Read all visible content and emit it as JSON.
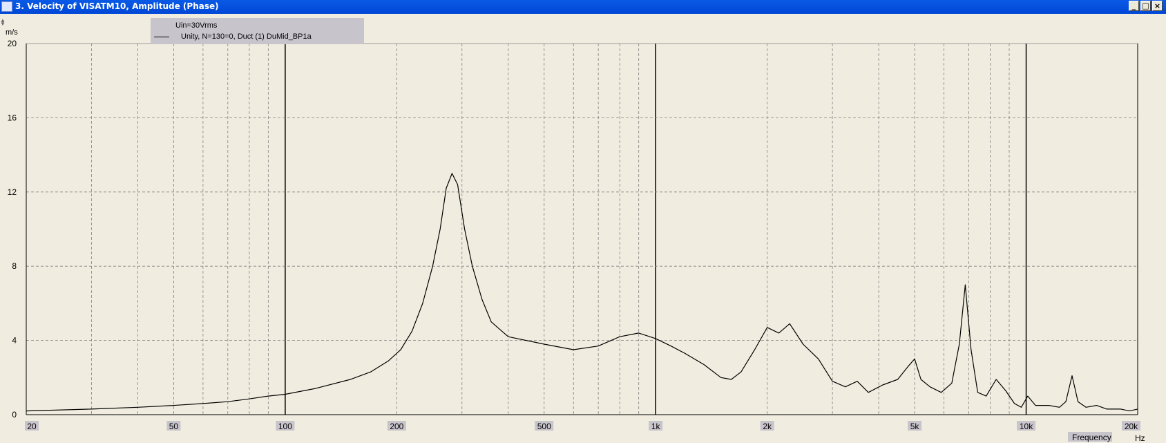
{
  "window": {
    "title": "3. Velocity of VISATM10, Amplitude (Phase)",
    "buttons": [
      "_",
      "□",
      "×"
    ]
  },
  "legend": {
    "header": "Uin=30Vrms",
    "series_label": "Unity, N=130=0, Duct (1) DuMid_BP1a"
  },
  "axes": {
    "y_unit": "m/s",
    "x_unit": "Hz",
    "x_title": "Frequency",
    "y_ticks": [
      "0",
      "4",
      "8",
      "12",
      "16",
      "20"
    ],
    "x_tick_labels": [
      "20",
      "50",
      "100",
      "200",
      "500",
      "1k",
      "2k",
      "5k",
      "10k",
      "20k"
    ]
  },
  "colors": {
    "background": "#f0ecdf",
    "grid": "#808080",
    "curve": "#000000",
    "titlebar": "#0054e3"
  },
  "chart_data": {
    "type": "line",
    "x_scale": "log",
    "xlim": [
      20,
      20000
    ],
    "ylim": [
      0,
      20
    ],
    "grid": true,
    "series": [
      {
        "name": "Unity, N=130=0, Duct (1) DuMid_BP1a",
        "points": [
          [
            20,
            0.2
          ],
          [
            30,
            0.3
          ],
          [
            40,
            0.4
          ],
          [
            50,
            0.5
          ],
          [
            60,
            0.6
          ],
          [
            70,
            0.7
          ],
          [
            80,
            0.85
          ],
          [
            90,
            1.0
          ],
          [
            100,
            1.1
          ],
          [
            120,
            1.4
          ],
          [
            150,
            1.9
          ],
          [
            170,
            2.3
          ],
          [
            190,
            2.9
          ],
          [
            205,
            3.5
          ],
          [
            220,
            4.5
          ],
          [
            235,
            6.0
          ],
          [
            250,
            8.0
          ],
          [
            262,
            10.0
          ],
          [
            272,
            12.2
          ],
          [
            282,
            13.0
          ],
          [
            292,
            12.4
          ],
          [
            305,
            10.0
          ],
          [
            320,
            8.0
          ],
          [
            340,
            6.2
          ],
          [
            360,
            5.0
          ],
          [
            400,
            4.2
          ],
          [
            500,
            3.8
          ],
          [
            600,
            3.5
          ],
          [
            700,
            3.7
          ],
          [
            800,
            4.2
          ],
          [
            900,
            4.4
          ],
          [
            1000,
            4.1
          ],
          [
            1100,
            3.7
          ],
          [
            1200,
            3.3
          ],
          [
            1350,
            2.7
          ],
          [
            1500,
            2.0
          ],
          [
            1600,
            1.9
          ],
          [
            1700,
            2.3
          ],
          [
            1850,
            3.5
          ],
          [
            2000,
            4.7
          ],
          [
            2150,
            4.4
          ],
          [
            2300,
            4.9
          ],
          [
            2500,
            3.8
          ],
          [
            2750,
            3.0
          ],
          [
            3000,
            1.8
          ],
          [
            3250,
            1.5
          ],
          [
            3500,
            1.8
          ],
          [
            3750,
            1.2
          ],
          [
            4100,
            1.6
          ],
          [
            4500,
            1.9
          ],
          [
            4800,
            2.6
          ],
          [
            5000,
            3.0
          ],
          [
            5200,
            1.9
          ],
          [
            5500,
            1.5
          ],
          [
            5900,
            1.2
          ],
          [
            6300,
            1.7
          ],
          [
            6600,
            3.8
          ],
          [
            6850,
            7.0
          ],
          [
            7100,
            3.5
          ],
          [
            7400,
            1.2
          ],
          [
            7800,
            1.0
          ],
          [
            8300,
            1.9
          ],
          [
            8800,
            1.3
          ],
          [
            9300,
            0.6
          ],
          [
            9700,
            0.4
          ],
          [
            10100,
            1.0
          ],
          [
            10600,
            0.5
          ],
          [
            11500,
            0.5
          ],
          [
            12300,
            0.4
          ],
          [
            12800,
            0.7
          ],
          [
            13300,
            2.1
          ],
          [
            13800,
            0.7
          ],
          [
            14500,
            0.4
          ],
          [
            15500,
            0.5
          ],
          [
            16500,
            0.3
          ],
          [
            18000,
            0.3
          ],
          [
            19000,
            0.2
          ],
          [
            20000,
            0.3
          ]
        ]
      }
    ]
  }
}
